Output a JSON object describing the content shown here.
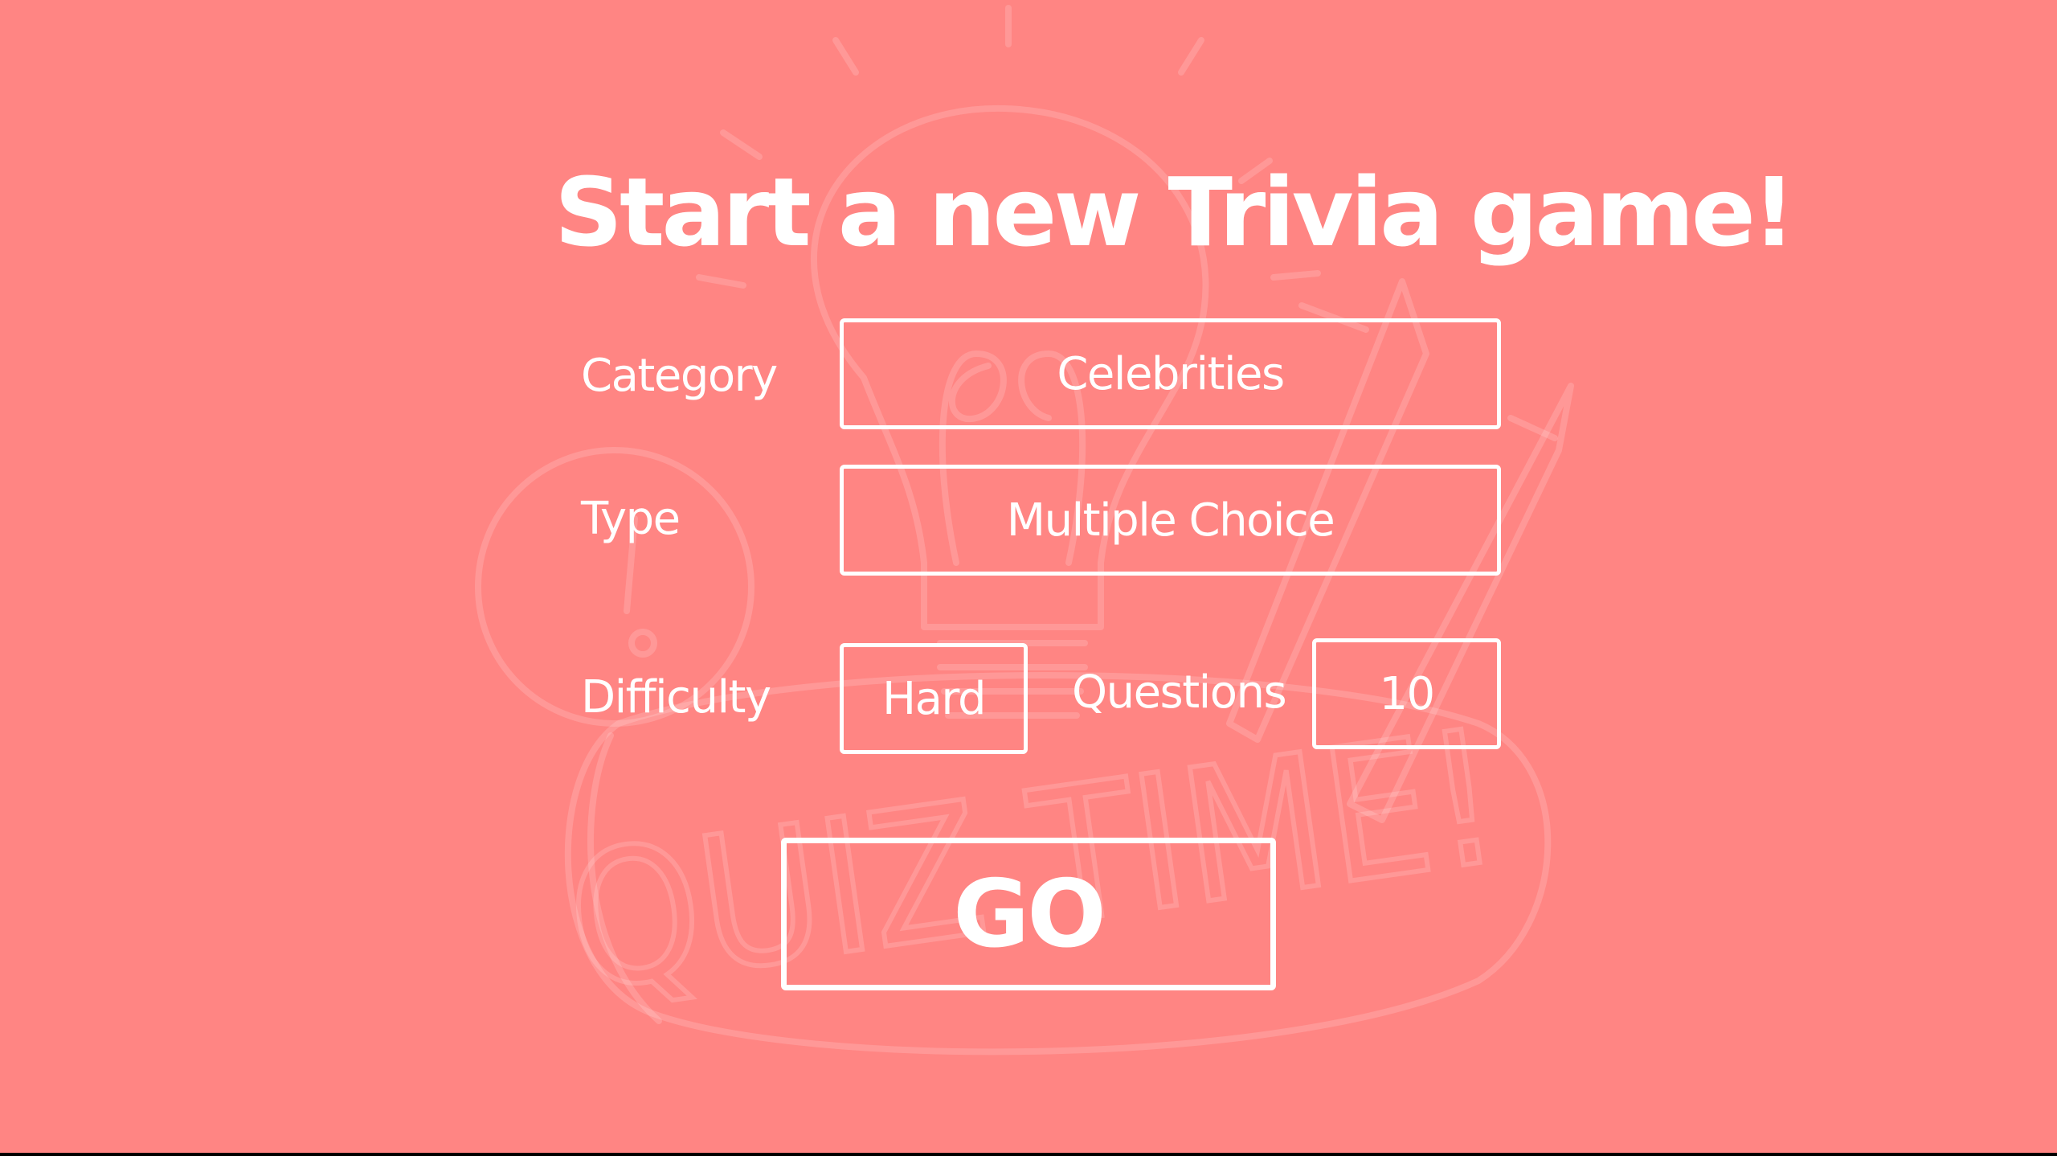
{
  "page": {
    "title": "Start a new Trivia game!",
    "background_color": "#ff8583",
    "foreground_color": "#ffffff"
  },
  "background_art": {
    "text": "QUIZ TIME!"
  },
  "form": {
    "category": {
      "label": "Category",
      "value": "Celebrities"
    },
    "type": {
      "label": "Type",
      "value": "Multiple  Choice"
    },
    "difficulty": {
      "label": "Difficulty",
      "value": "Hard"
    },
    "questions": {
      "label": "Questions",
      "value": "10"
    }
  },
  "go_button": {
    "label": "GO"
  }
}
